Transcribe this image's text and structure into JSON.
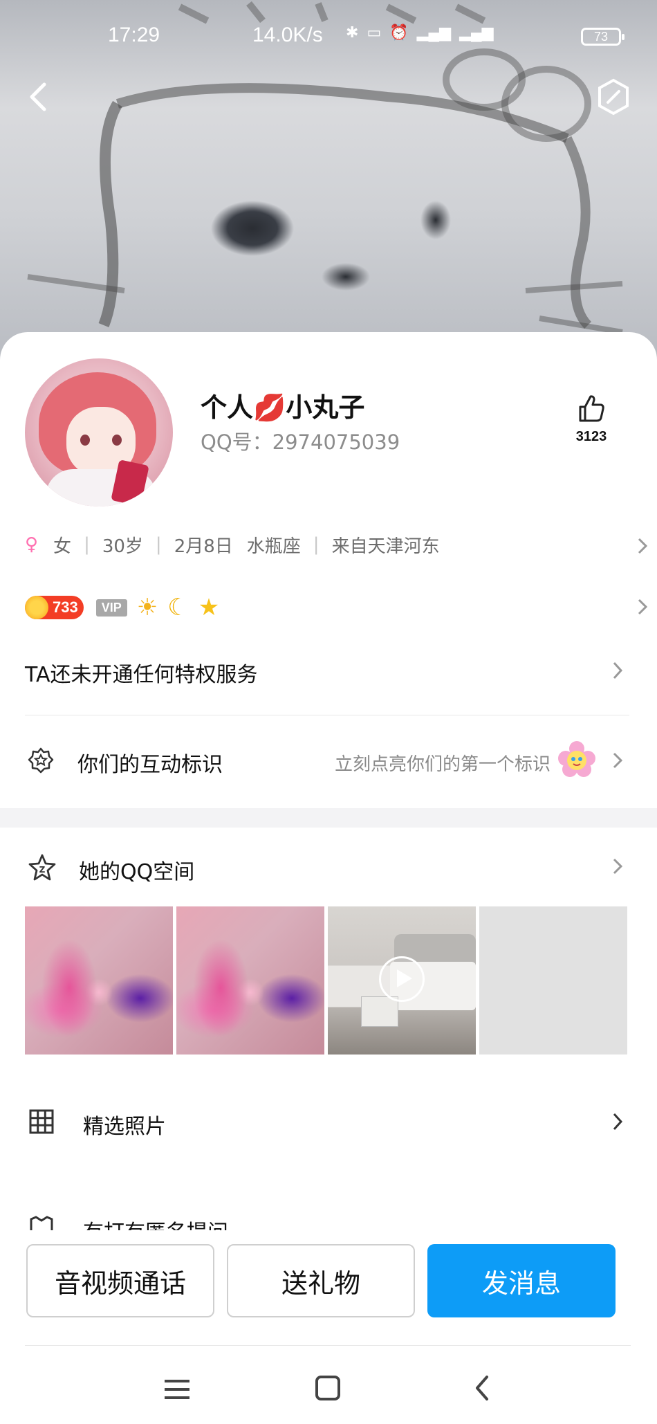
{
  "status_bar": {
    "time": "17:29",
    "speed": "14.0K/s",
    "battery": "73"
  },
  "profile": {
    "name": "个人💋小丸子",
    "qq_label": "QQ号：2974075039",
    "likes": "3123"
  },
  "info": {
    "gender": "女",
    "age": "30岁",
    "birthday": "2月8日",
    "zodiac": "水瓶座",
    "location": "来自天津河东"
  },
  "badges": {
    "level": "733",
    "vip": "VIP"
  },
  "privilege_text": "TA还未开通任何特权服务",
  "interaction": {
    "label": "你们的互动标识",
    "hint": "立刻点亮你们的第一个标识"
  },
  "qzone": {
    "label": "她的QQ空间"
  },
  "featured": {
    "label": "精选照片"
  },
  "cut_row": {
    "label": "有打有匿名提问"
  },
  "actions": {
    "call": "音视频通话",
    "gift": "送礼物",
    "message": "发消息"
  },
  "colors": {
    "accent": "#0d9cf7",
    "level_badge": "#f33d25",
    "gender": "#ff6fb0"
  }
}
